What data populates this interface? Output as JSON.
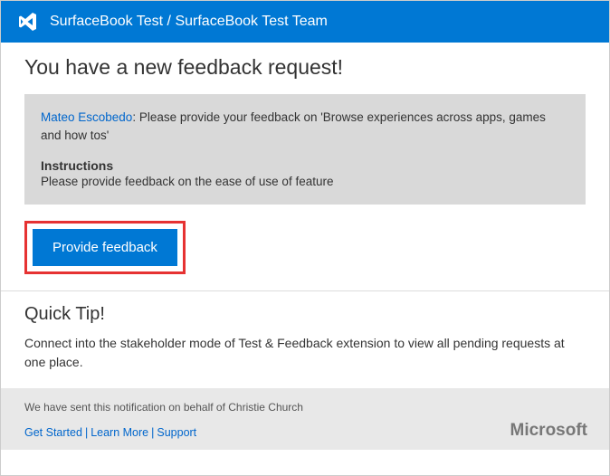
{
  "header": {
    "title": "SurfaceBook Test / SurfaceBook Test Team"
  },
  "main": {
    "page_title": "You have a new feedback request!",
    "requester_name": "Mateo Escobedo",
    "request_text": ": Please provide your feedback on 'Browse experiences across  apps, games and how tos'",
    "instructions_label": "Instructions",
    "instructions_text": "Please provide feedback on the ease of use of feature",
    "button_label": "Provide feedback"
  },
  "tip": {
    "title": "Quick Tip!",
    "text": "Connect into the stakeholder mode of Test & Feedback extension to view all pending requests at one place."
  },
  "footer": {
    "notice_prefix": "We have sent this notification on behalf of ",
    "notice_name": "Christie Church",
    "links": {
      "get_started": "Get Started",
      "learn_more": "Learn More",
      "support": "Support"
    },
    "logo": "Microsoft"
  }
}
